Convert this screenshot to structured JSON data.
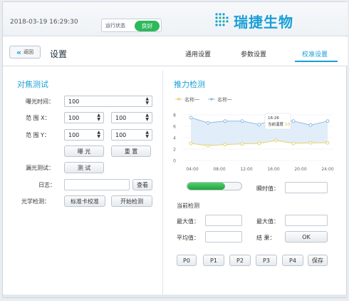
{
  "header": {
    "datetime": "2018-03-19  16:29:30",
    "status_label": "运行状态",
    "status_value": "良好",
    "logo_text": "瑞捷生物",
    "brand_color": "#1a9fd6",
    "status_color": "#2eb85c"
  },
  "nav": {
    "back_label": "返回",
    "page_title": "设置",
    "tabs": [
      {
        "label": "通用设置"
      },
      {
        "label": "参数设置"
      },
      {
        "label": "校准设置",
        "active": true
      }
    ]
  },
  "focus_test": {
    "title": "对焦测试",
    "exposure_label": "曝光时间：",
    "exposure_value": "100",
    "range_x_label": "范  围  X：",
    "range_x_min": "100",
    "range_x_max": "100",
    "range_y_label": "范  围  Y：",
    "range_y_min": "100",
    "range_y_max": "100",
    "expose_button": "曝 光",
    "reset_button": "重 置",
    "leak_label": "漏光测试：",
    "test_button": "测 试",
    "log_label": "日志：",
    "view_button": "查看",
    "optical_label": "光学检测：",
    "calibrate_button": "标准卡校准",
    "start_button": "开始检测"
  },
  "thrust_test": {
    "title": "推力检测",
    "instant_label": "瞬时值：",
    "current_label": "当前检测",
    "max_label_1": "最大值：",
    "max_label_2": "最大值：",
    "avg_label": "平均值：",
    "result_label": "结  果：",
    "ok_button": "OK",
    "progress": 0.7,
    "p_buttons": [
      "P0",
      "P1",
      "P2",
      "P3",
      "P4"
    ],
    "save_button": "保存"
  },
  "chart_data": {
    "type": "line",
    "categories": [
      "04:00",
      "08:00",
      "12:00",
      "16:00",
      "20:00",
      "24:00"
    ],
    "ylim": [
      0,
      8
    ],
    "yticks": [
      "0",
      "2",
      "4",
      "6",
      "8"
    ],
    "series": [
      {
        "name": "名称一",
        "color": "#e8d36a",
        "values": [
          3.0,
          2.6,
          2.8,
          2.9,
          3.0,
          3.5,
          3.0,
          3.1,
          3.1
        ]
      },
      {
        "name": "名称一",
        "color": "#8fbde6",
        "values": [
          7.5,
          6.6,
          6.9,
          6.9,
          6.3,
          7.4,
          6.9,
          6.2,
          6.9
        ]
      }
    ],
    "tooltip": {
      "time": "16:26",
      "label": "当前温度",
      "value": "10"
    }
  }
}
